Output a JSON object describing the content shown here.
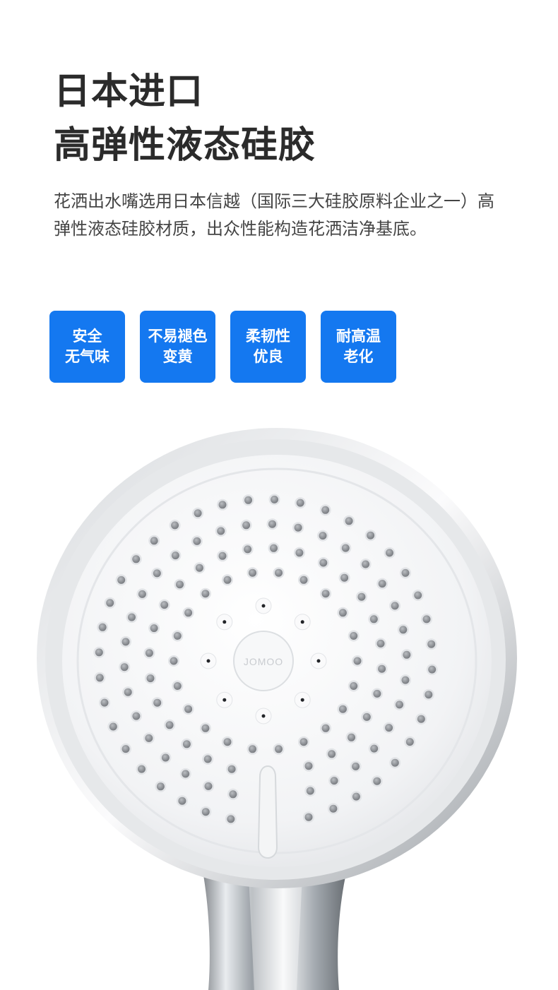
{
  "headline": {
    "line1": "日本进口",
    "line2": "高弹性液态硅胶"
  },
  "description": "花洒出水嘴选用日本信越（国际三大硅胶原料企业之一）高弹性液态硅胶材质，出众性能构造花洒洁净基底。",
  "badges": [
    {
      "line1": "安全",
      "line2": "无气味"
    },
    {
      "line1": "不易褪色",
      "line2": "变黄"
    },
    {
      "line1": "柔韧性",
      "line2": "优良"
    },
    {
      "line1": "耐高温",
      "line2": "老化"
    }
  ],
  "product": {
    "name": "shower-head",
    "logo_text": "JOMOO"
  },
  "colors": {
    "accent": "#1478f0",
    "headline": "#2b2b2b",
    "body_text": "#444444",
    "nozzle": "#8c8f94",
    "face": "#f2f3f5"
  }
}
